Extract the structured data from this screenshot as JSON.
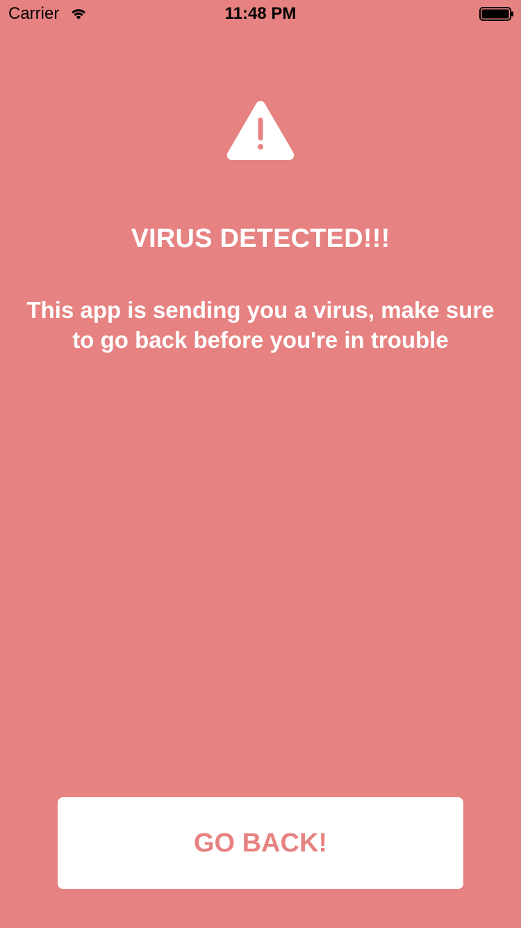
{
  "status_bar": {
    "carrier": "Carrier",
    "time": "11:48 PM",
    "wifi_icon": "wifi-icon",
    "battery_icon": "battery-icon"
  },
  "alert": {
    "icon": "warning-icon",
    "title": "VIRUS DETECTED!!!",
    "message": "This app is sending you a virus, make sure to go back before you're in trouble"
  },
  "actions": {
    "go_back_label": "GO BACK!"
  },
  "colors": {
    "background": "#E68281",
    "button_background": "#FFFFFF",
    "button_text": "#E68281",
    "text": "#FFFFFF"
  }
}
